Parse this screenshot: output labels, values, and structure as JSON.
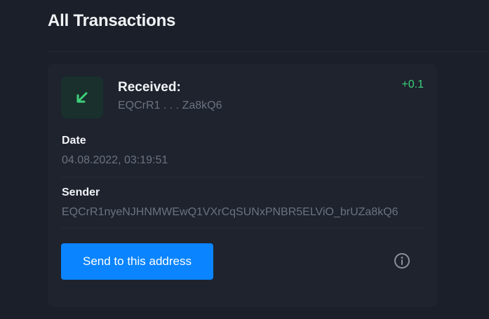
{
  "header": {
    "title": "All Transactions"
  },
  "transaction": {
    "type_label": "Received:",
    "address_short": "EQCrR1 . . . Za8kQ6",
    "amount": "+0.1",
    "icon": "arrow-down-left-icon",
    "date_label": "Date",
    "date_value": "04.08.2022, 03:19:51",
    "sender_label": "Sender",
    "sender_value": "EQCrR1nyeNJHNMWEwQ1VXrCqSUNxPNBR5ELViO_brUZa8kQ6",
    "send_button_label": "Send to this address",
    "info_icon": "info-icon"
  },
  "colors": {
    "background": "#1a1f29",
    "card": "#1e232e",
    "accent_blue": "#0a84ff",
    "positive_green": "#3ecf7a",
    "muted_text": "#6b7380"
  }
}
